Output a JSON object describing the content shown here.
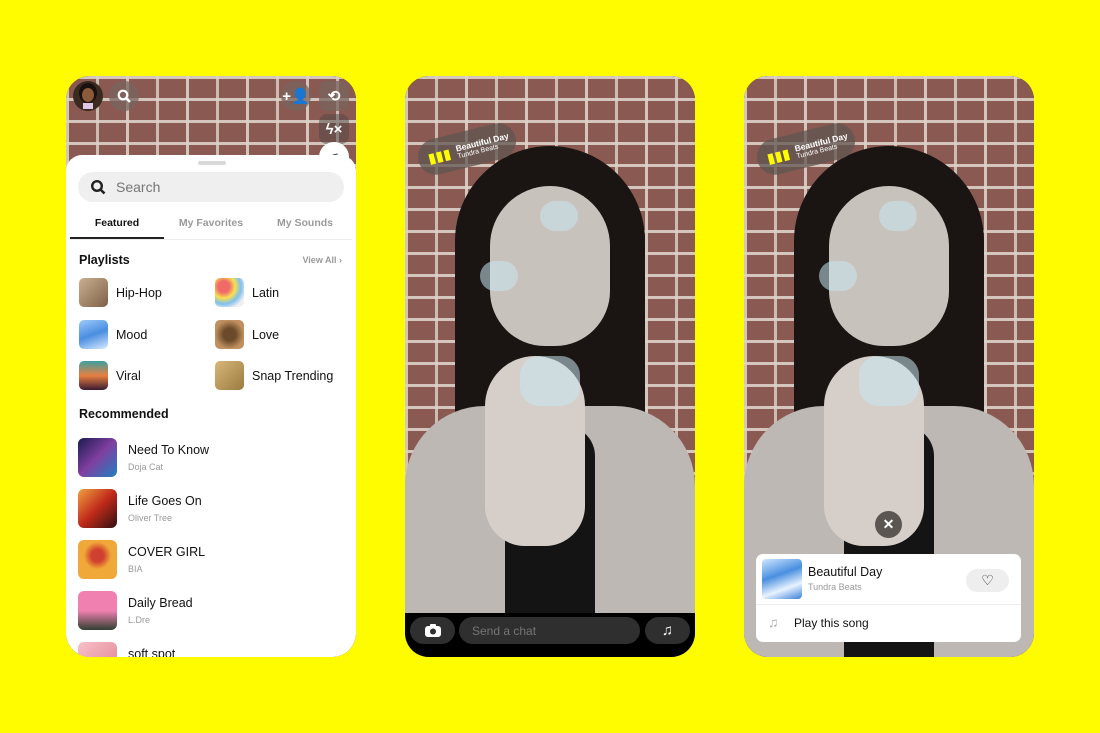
{
  "background_color": "#FFFC00",
  "panel1": {
    "top_icons": {
      "avatar": "bitmoji-avatar",
      "search": "search-icon",
      "add_friend": "add-friend-icon",
      "flip_camera": "flip-camera-icon",
      "flash": "flash-off-icon",
      "music": "music-icon"
    },
    "search": {
      "placeholder": "Search"
    },
    "tabs": [
      "Featured",
      "My Favorites",
      "My Sounds"
    ],
    "active_tab": "Featured",
    "playlists_heading": "Playlists",
    "view_all": "View All",
    "playlists": [
      {
        "label": "Hip-Hop",
        "color": "#a08060"
      },
      {
        "label": "Latin",
        "color": "#e8a0a0"
      },
      {
        "label": "Mood",
        "color": "#6aa8e8"
      },
      {
        "label": "Love",
        "color": "#b8875a"
      },
      {
        "label": "Viral",
        "color": "#d66a3a"
      },
      {
        "label": "Snap Trending",
        "color": "#b89a60"
      }
    ],
    "recommended_heading": "Recommended",
    "recommended": [
      {
        "title": "Need To Know",
        "artist": "Doja Cat",
        "color": "#2a2060"
      },
      {
        "title": "Life Goes On",
        "artist": "Oliver Tree",
        "color": "#c84a1a"
      },
      {
        "title": "COVER GIRL",
        "artist": "BIA",
        "color": "#f0a030"
      },
      {
        "title": "Daily Bread",
        "artist": "L.Dre",
        "color": "#e07a90"
      },
      {
        "title": "soft spot",
        "artist": "",
        "color": "#f0b0b8"
      }
    ]
  },
  "panel2": {
    "sticker": {
      "title": "Beautiful Day",
      "artist": "Tundra Beats"
    },
    "chat_placeholder": "Send a chat"
  },
  "panel3": {
    "sticker": {
      "title": "Beautiful Day",
      "artist": "Tundra Beats"
    },
    "card": {
      "title": "Beautiful Day",
      "artist": "Tundra Beats",
      "action": "Play this song"
    }
  }
}
